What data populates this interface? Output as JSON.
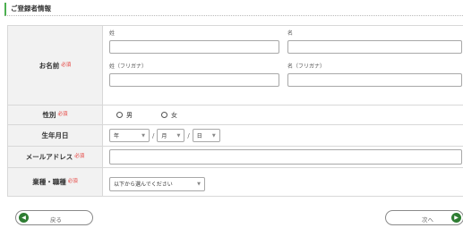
{
  "section": {
    "title": "ご登録者情報"
  },
  "required_mark": "必須",
  "name": {
    "label": "お名前",
    "last_label": "姓",
    "first_label": "名",
    "last_kana_label": "姓（フリガナ）",
    "first_kana_label": "名（フリガナ）"
  },
  "gender": {
    "label": "性別",
    "options": [
      "男",
      "女"
    ]
  },
  "dob": {
    "label": "生年月日",
    "year": "年",
    "month": "月",
    "day": "日",
    "separator": "/"
  },
  "email": {
    "label": "メールアドレス"
  },
  "occupation": {
    "label": "業種・職種",
    "selected": "以下から選んでください"
  },
  "nav": {
    "back_label": "戻る",
    "next_label": "次へ"
  },
  "colors": {
    "accent": "#2e7d32",
    "required": "#e53935",
    "label_bg": "#f2f2f2"
  }
}
